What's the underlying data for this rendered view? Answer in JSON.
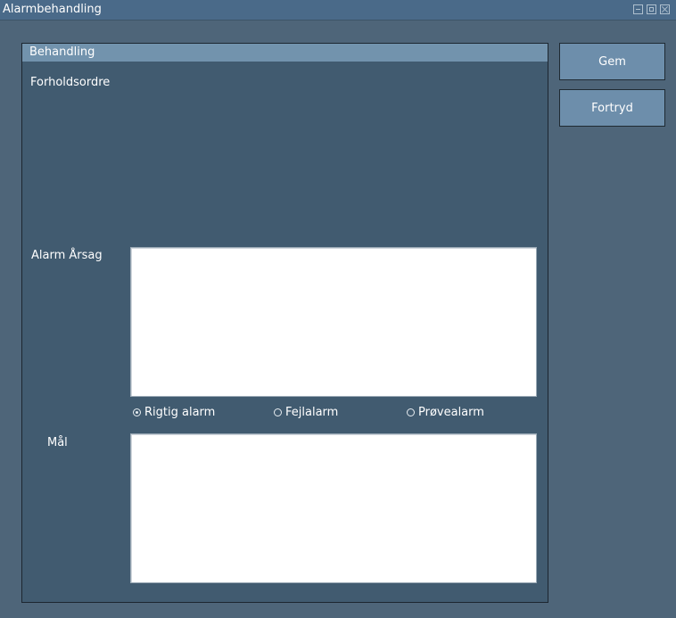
{
  "window": {
    "title": "Alarmbehandling"
  },
  "panel": {
    "header": "Behandling",
    "instructions_label": "Forholdsordre",
    "cause_label": "Alarm Årsag",
    "cause_value": "",
    "goal_label": "Mål",
    "goal_value": "",
    "alarm_type_options": [
      "Rigtig alarm",
      "Fejlalarm",
      "Prøvealarm"
    ],
    "alarm_type_selected": "Rigtig alarm"
  },
  "buttons": {
    "save": "Gem",
    "undo": "Fortryd"
  }
}
